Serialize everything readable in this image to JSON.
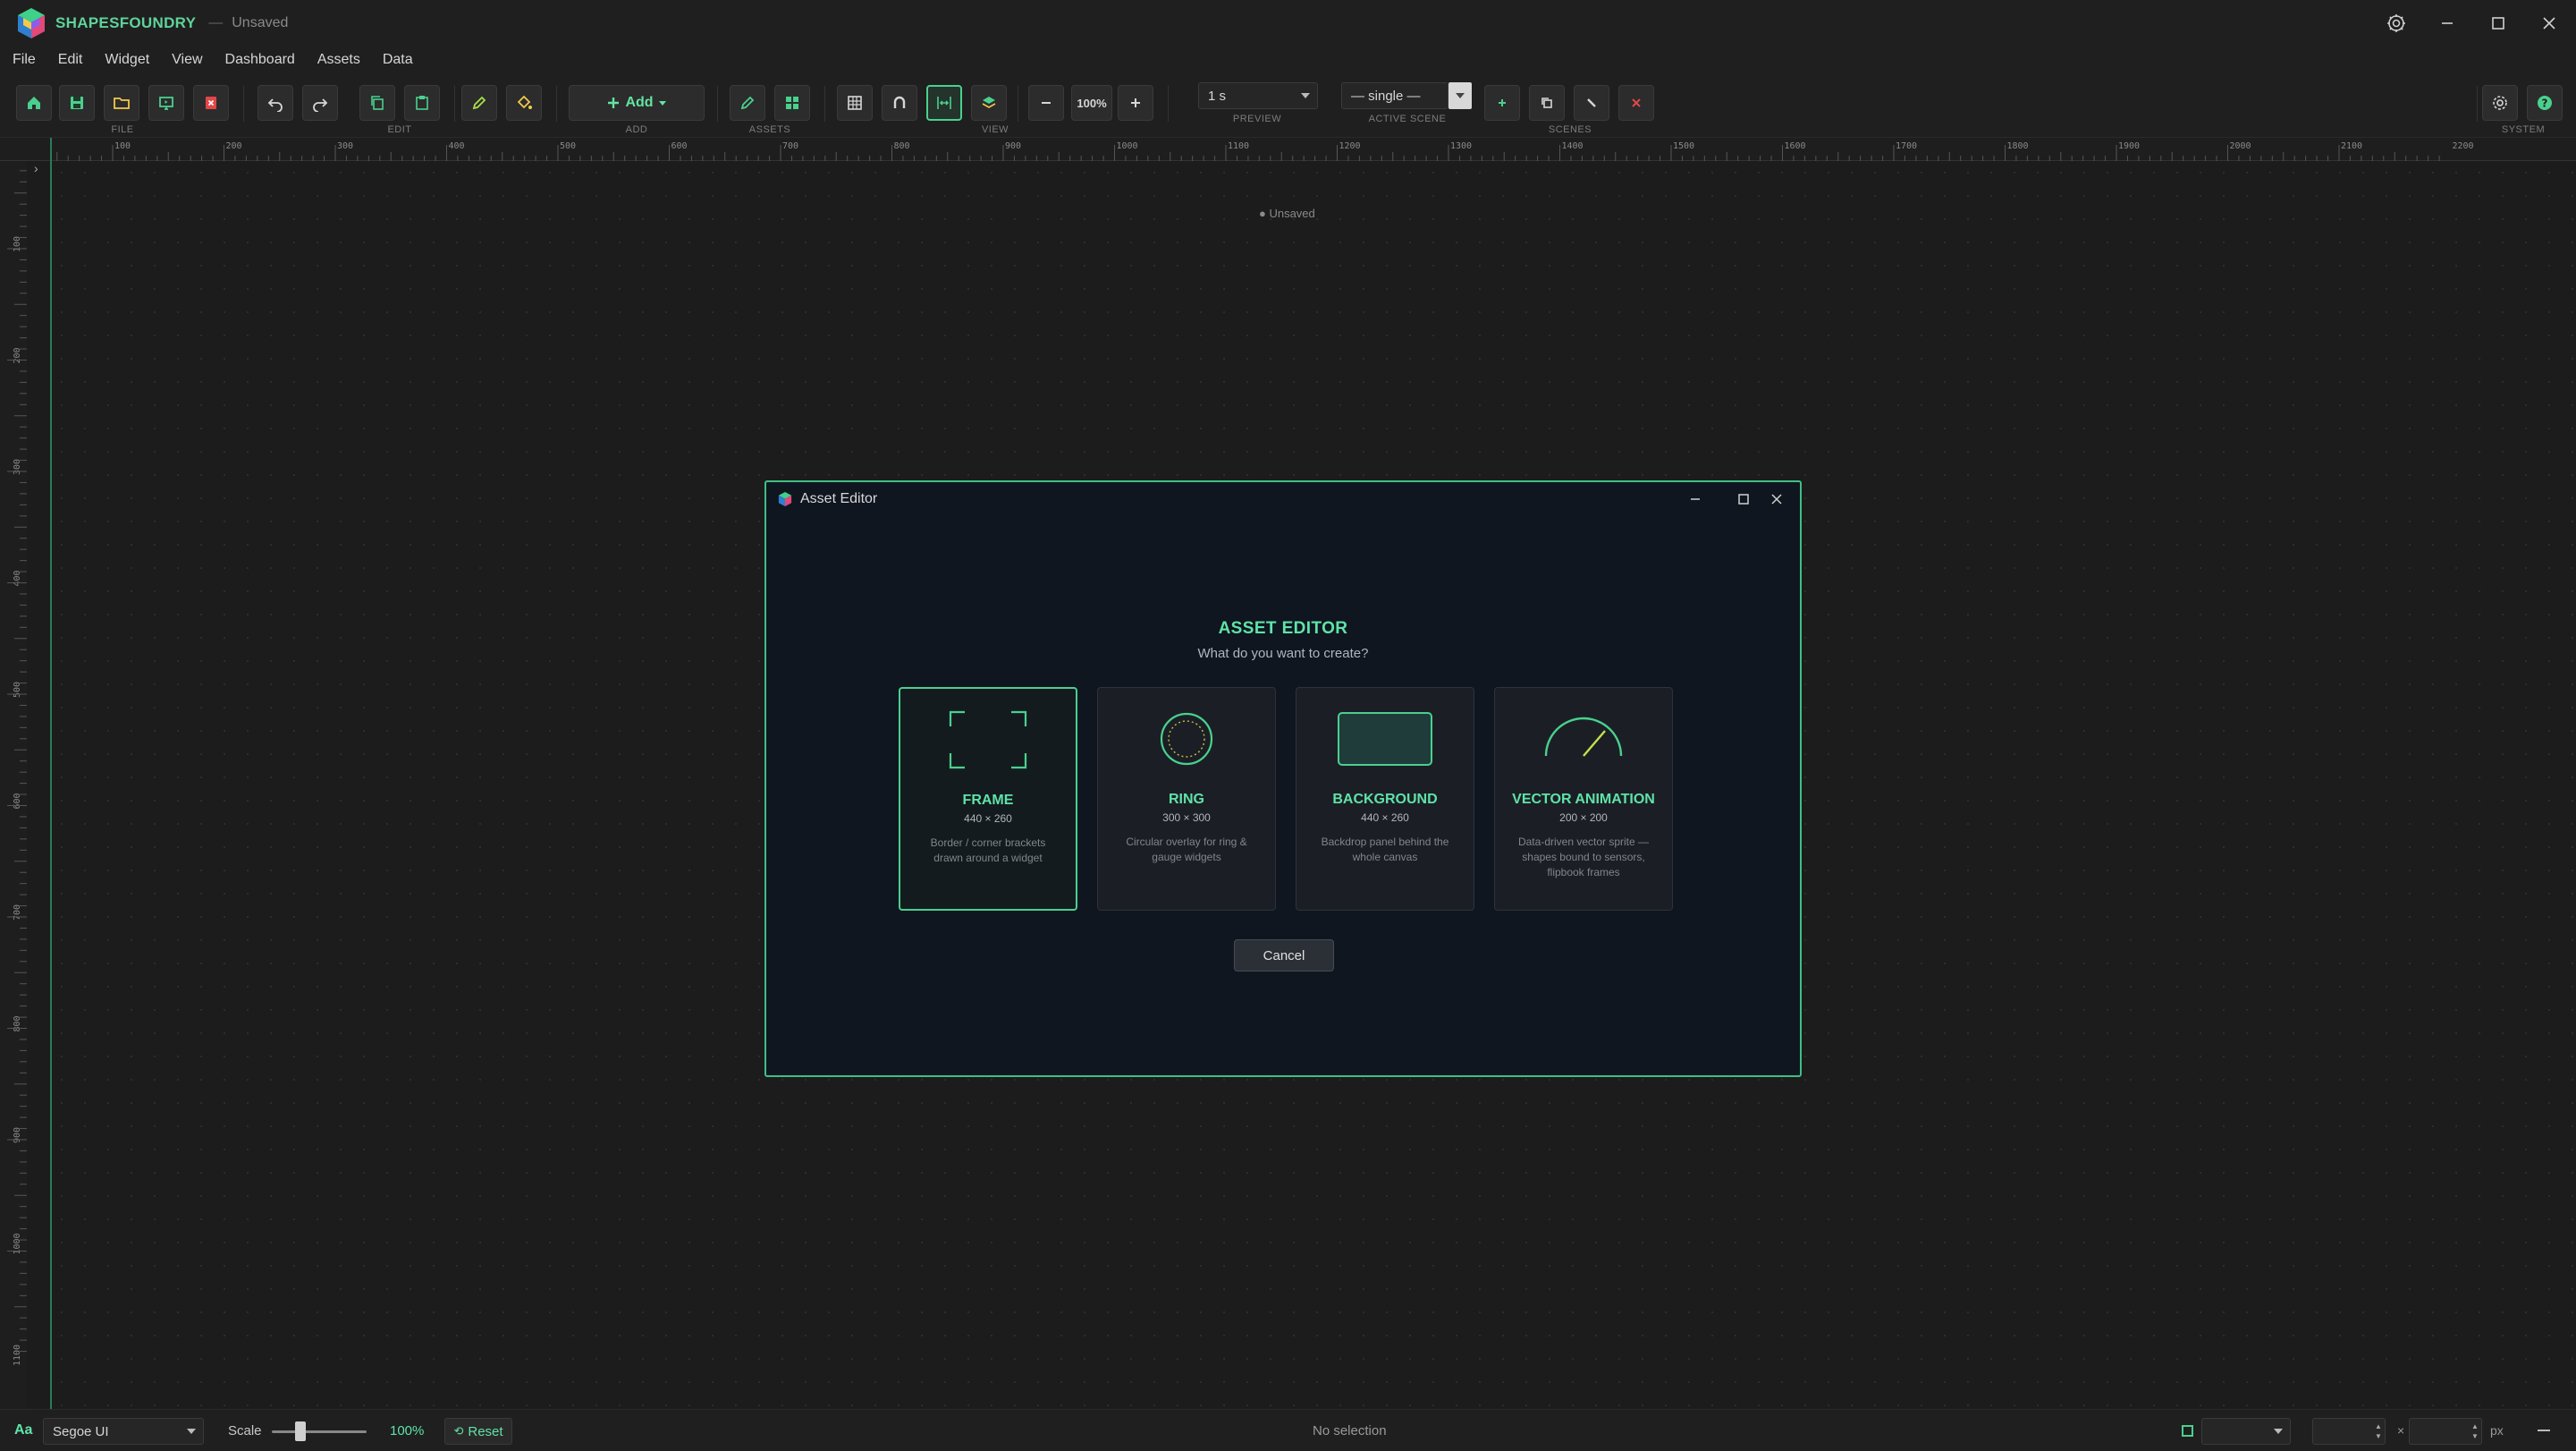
{
  "window": {
    "app_name": "SHAPESFOUNDRY",
    "separator": "—",
    "document": "Unsaved"
  },
  "menu": [
    "File",
    "Edit",
    "Widget",
    "View",
    "Dashboard",
    "Assets",
    "Data"
  ],
  "toolbar": {
    "groups": {
      "file": "FILE",
      "edit": "EDIT",
      "add": "ADD",
      "assets": "ASSETS",
      "view": "VIEW",
      "preview": "PREVIEW",
      "active_scene": "ACTIVE SCENE",
      "scenes": "SCENES",
      "system": "SYSTEM"
    },
    "add_label": "Add",
    "zoom_value": "100%",
    "preview_value": "1 s",
    "active_scene_value": "— single —"
  },
  "ruler": {
    "horizontal_ticks": [
      "100",
      "200",
      "300",
      "400",
      "500",
      "600",
      "700",
      "800",
      "900",
      "1000",
      "1100",
      "1200",
      "1300",
      "1400",
      "1500",
      "1600",
      "1700",
      "1800",
      "1900",
      "2000",
      "2100",
      "2200"
    ],
    "vertical_ticks": [
      "100",
      "200",
      "300",
      "400",
      "500",
      "600",
      "700",
      "800",
      "900",
      "1000",
      "1100"
    ]
  },
  "canvas": {
    "unsaved_tag": "● Unsaved"
  },
  "modal": {
    "title": "Asset Editor",
    "heading": "ASSET EDITOR",
    "subheading": "What do you want to create?",
    "cards": [
      {
        "name": "FRAME",
        "size": "440 × 260",
        "description": "Border / corner brackets drawn around a widget"
      },
      {
        "name": "RING",
        "size": "300 × 300",
        "description": "Circular overlay for ring & gauge widgets"
      },
      {
        "name": "BACKGROUND",
        "size": "440 × 260",
        "description": "Backdrop panel behind the whole canvas"
      },
      {
        "name": "VECTOR ANIMATION",
        "size": "200 × 200",
        "description": "Data-driven vector sprite — shapes bound to sensors, flipbook frames"
      }
    ],
    "cancel_label": "Cancel"
  },
  "status": {
    "font_icon": "Aa",
    "font_value": "Segoe UI",
    "scale_label": "Scale",
    "scale_value": "100%",
    "scale_fraction": 0.3,
    "reset_label": "Reset",
    "selection_text": "No selection",
    "times": "×",
    "unit": "px"
  },
  "colors": {
    "accent": "#5fe3a8",
    "accent_border": "#3fbf85",
    "background": "#1c1c1c",
    "modal_background": "#0f1620"
  }
}
